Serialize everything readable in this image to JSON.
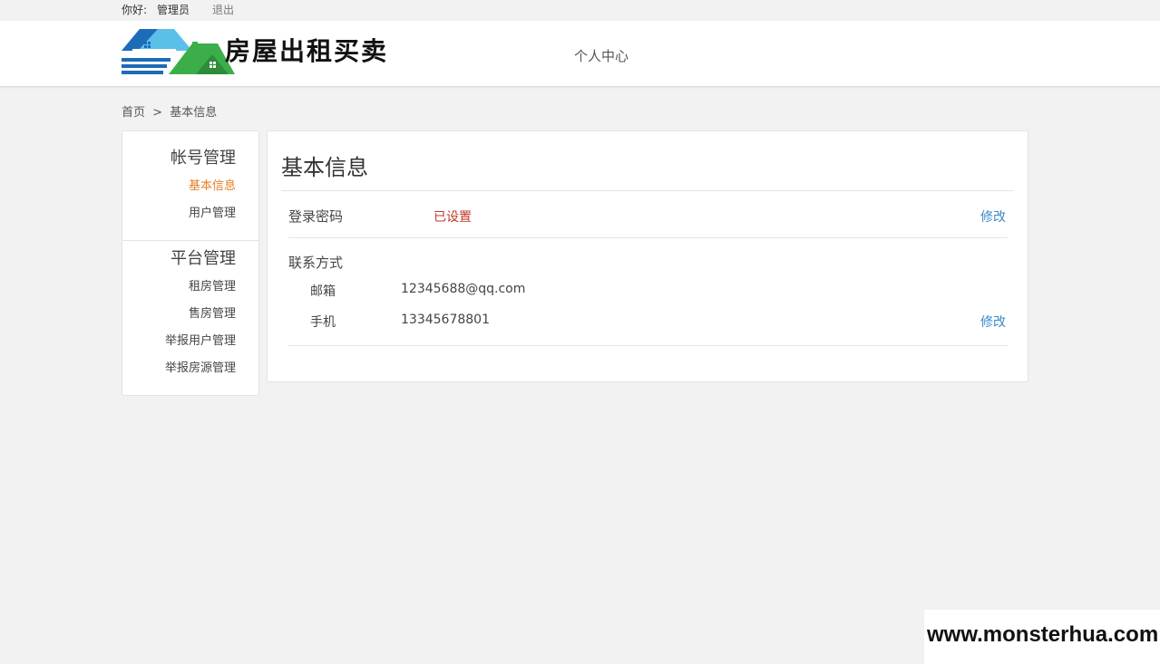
{
  "topbar": {
    "greeting": "你好:",
    "username": "管理员",
    "logout": "退出"
  },
  "header": {
    "site_title": "房屋出租买卖",
    "nav": "个人中心",
    "logo_colors": {
      "blue": "#1e6bb8",
      "green": "#3cae49",
      "sky": "#5bc0e8"
    }
  },
  "breadcrumb": {
    "home": "首页",
    "separator": ">",
    "current": "基本信息"
  },
  "sidebar": {
    "groups": [
      {
        "title": "帐号管理",
        "items": [
          "基本信息",
          "用户管理"
        ]
      },
      {
        "title": "平台管理",
        "items": [
          "租房管理",
          "售房管理",
          "举报用户管理",
          "举报房源管理"
        ]
      }
    ],
    "active_item": "基本信息"
  },
  "panel": {
    "title": "基本信息",
    "password": {
      "label": "登录密码",
      "status": "已设置",
      "edit": "修改"
    },
    "contact": {
      "label": "联系方式",
      "email_label": "邮箱",
      "email": "12345688@qq.com",
      "phone_label": "手机",
      "phone": "13345678801",
      "edit": "修改"
    }
  },
  "watermark": "www.monsterhua.com",
  "colors": {
    "accent_orange": "#e67e22",
    "link_blue": "#3a8ac8",
    "status_red": "#c0392b"
  }
}
